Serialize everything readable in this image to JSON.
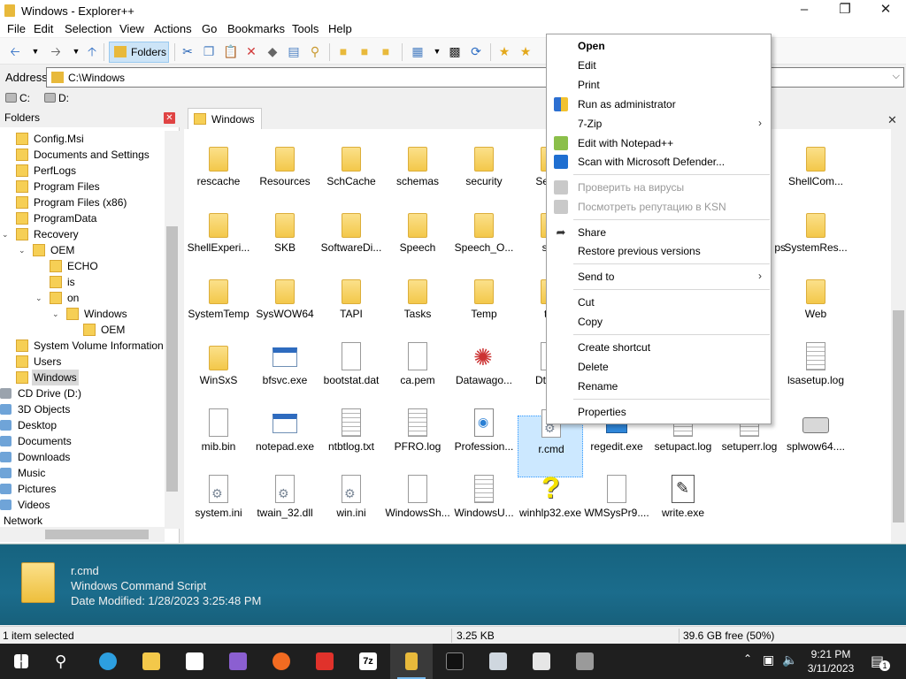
{
  "window": {
    "title": "Windows - Explorer++"
  },
  "menu": [
    "File",
    "Edit",
    "Selection",
    "View",
    "Actions",
    "Go",
    "Bookmarks",
    "Tools",
    "Help"
  ],
  "toolbar": {
    "folders_label": "Folders"
  },
  "address": {
    "label": "Address",
    "value": "C:\\Windows"
  },
  "drives": [
    "C:",
    "D:"
  ],
  "folders_pane": {
    "title": "Folders",
    "tree": [
      {
        "label": "Config.Msi"
      },
      {
        "label": "Documents and Settings"
      },
      {
        "label": "PerfLogs"
      },
      {
        "label": "Program Files"
      },
      {
        "label": "Program Files (x86)"
      },
      {
        "label": "ProgramData"
      },
      {
        "label": "Recovery"
      },
      {
        "label": "OEM"
      },
      {
        "label": "ECHO"
      },
      {
        "label": "is"
      },
      {
        "label": "on"
      },
      {
        "label": "Windows"
      },
      {
        "label": "OEM"
      },
      {
        "label": "System Volume Information"
      },
      {
        "label": "Users"
      },
      {
        "label": "Windows"
      },
      {
        "label": "CD Drive (D:)"
      },
      {
        "label": "3D Objects"
      },
      {
        "label": "Desktop"
      },
      {
        "label": "Documents"
      },
      {
        "label": "Downloads"
      },
      {
        "label": "Music"
      },
      {
        "label": "Pictures"
      },
      {
        "label": "Videos"
      },
      {
        "label": "Network"
      }
    ]
  },
  "tab": {
    "label": "Windows"
  },
  "files": [
    {
      "name": "rescache"
    },
    {
      "name": "Resources"
    },
    {
      "name": "SchCache"
    },
    {
      "name": "schemas"
    },
    {
      "name": "security"
    },
    {
      "name": "Servic"
    },
    {
      "name": "ShellCom..."
    },
    {
      "name": "ShellExperi..."
    },
    {
      "name": "SKB"
    },
    {
      "name": "SoftwareDi..."
    },
    {
      "name": "Speech"
    },
    {
      "name": "Speech_O..."
    },
    {
      "name": "syn"
    },
    {
      "name": "ps"
    },
    {
      "name": "SystemRes..."
    },
    {
      "name": "SystemTemp"
    },
    {
      "name": "SysWOW64"
    },
    {
      "name": "TAPI"
    },
    {
      "name": "Tasks"
    },
    {
      "name": "Temp"
    },
    {
      "name": "tra"
    },
    {
      "name": "Web"
    },
    {
      "name": "WinSxS"
    },
    {
      "name": "bfsvc.exe"
    },
    {
      "name": "bootstat.dat"
    },
    {
      "name": "ca.pem"
    },
    {
      "name": "Datawago..."
    },
    {
      "name": "DtcIns"
    },
    {
      "name": "lsasetup.log"
    },
    {
      "name": "mib.bin"
    },
    {
      "name": "notepad.exe"
    },
    {
      "name": "ntbtlog.txt"
    },
    {
      "name": "PFRO.log"
    },
    {
      "name": "Profession..."
    },
    {
      "name": "r.cmd"
    },
    {
      "name": "regedit.exe"
    },
    {
      "name": "setupact.log"
    },
    {
      "name": "setuperr.log"
    },
    {
      "name": "splwow64...."
    },
    {
      "name": "system.ini"
    },
    {
      "name": "twain_32.dll"
    },
    {
      "name": "win.ini"
    },
    {
      "name": "WindowsSh..."
    },
    {
      "name": "WindowsU..."
    },
    {
      "name": "winhlp32.exe"
    },
    {
      "name": "WMSysPr9...."
    },
    {
      "name": "write.exe"
    }
  ],
  "info": {
    "name": "r.cmd",
    "type": "Windows Command Script",
    "modified": "Date Modified: 1/28/2023 3:25:48 PM"
  },
  "status": {
    "selected": "1 item selected",
    "size": "3.25 KB",
    "free": "39.6 GB free (50%)"
  },
  "taskbar": {
    "time": "9:21 PM",
    "date": "3/11/2023",
    "notification_count": "1"
  },
  "context_menu": {
    "items": [
      {
        "label": "Open"
      },
      {
        "label": "Edit"
      },
      {
        "label": "Print"
      },
      {
        "label": "Run as administrator"
      },
      {
        "label": "7-Zip"
      },
      {
        "label": "Edit with Notepad++"
      },
      {
        "label": "Scan with Microsoft Defender..."
      },
      {
        "label": "Проверить на вирусы"
      },
      {
        "label": "Посмотреть репутацию в KSN"
      },
      {
        "label": "Share"
      },
      {
        "label": "Restore previous versions"
      },
      {
        "label": "Send to"
      },
      {
        "label": "Cut"
      },
      {
        "label": "Copy"
      },
      {
        "label": "Create shortcut"
      },
      {
        "label": "Delete"
      },
      {
        "label": "Rename"
      },
      {
        "label": "Properties"
      }
    ]
  },
  "colors": {
    "accent": "#0078d7",
    "selection": "#cce8ff",
    "info_bar": "#1b6c8c",
    "folder": "#f6cf55"
  }
}
